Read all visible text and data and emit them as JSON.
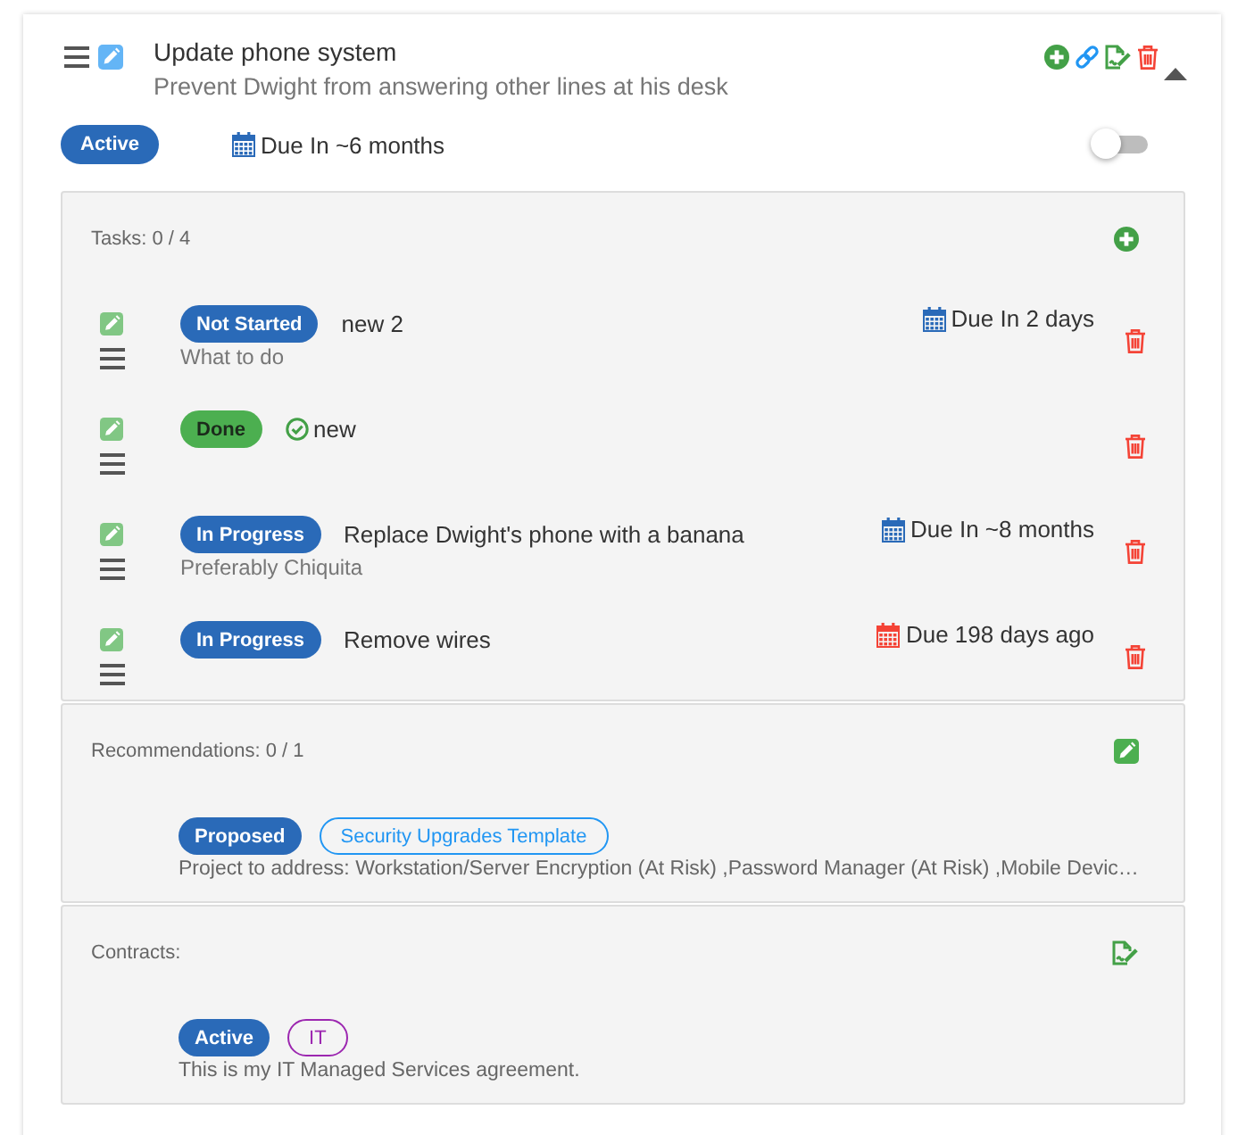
{
  "project": {
    "title": "Update phone system",
    "description": "Prevent Dwight from answering other lines at his desk",
    "expanded": true,
    "status": {
      "label": "Active",
      "color": "#2a6ab8"
    },
    "due": {
      "text": "Due In ~6 months",
      "overdue": false
    },
    "toggle": {
      "on": false
    }
  },
  "tasks": {
    "heading": "Tasks: 0 / 4",
    "items": [
      {
        "status": {
          "label": "Not Started",
          "color": "#2a6ab8"
        },
        "title": "new 2",
        "completed": false,
        "description": "What to do",
        "due": {
          "text": "Due In 2 days",
          "overdue": false
        }
      },
      {
        "status": {
          "label": "Done",
          "color": "#4caf50"
        },
        "title": "new",
        "completed": true
      },
      {
        "status": {
          "label": "In Progress",
          "color": "#2a6ab8"
        },
        "title": "Replace Dwight's phone with a banana",
        "completed": false,
        "description": "Preferably Chiquita",
        "due": {
          "text": "Due In ~8 months",
          "overdue": false
        }
      },
      {
        "status": {
          "label": "In Progress",
          "color": "#2a6ab8"
        },
        "title": "Remove wires",
        "completed": false,
        "due": {
          "text": "Due 198 days ago",
          "overdue": true
        }
      }
    ]
  },
  "recommendations": {
    "heading": "Recommendations: 0 / 1",
    "items": [
      {
        "status": {
          "label": "Proposed",
          "color": "#2a6ab8"
        },
        "tag": {
          "label": "Security Upgrades Template",
          "color": "#2196f3"
        },
        "description": "Project to address: Workstation/Server Encryption (At Risk) ,Password Manager (At Risk) ,Mobile Devic…"
      }
    ]
  },
  "contracts": {
    "heading": "Contracts:",
    "items": [
      {
        "status": {
          "label": "Active",
          "color": "#2a6ab8"
        },
        "tag": {
          "label": "IT",
          "color": "#9c27b0"
        },
        "description": "This is my IT Managed Services agreement."
      }
    ]
  }
}
